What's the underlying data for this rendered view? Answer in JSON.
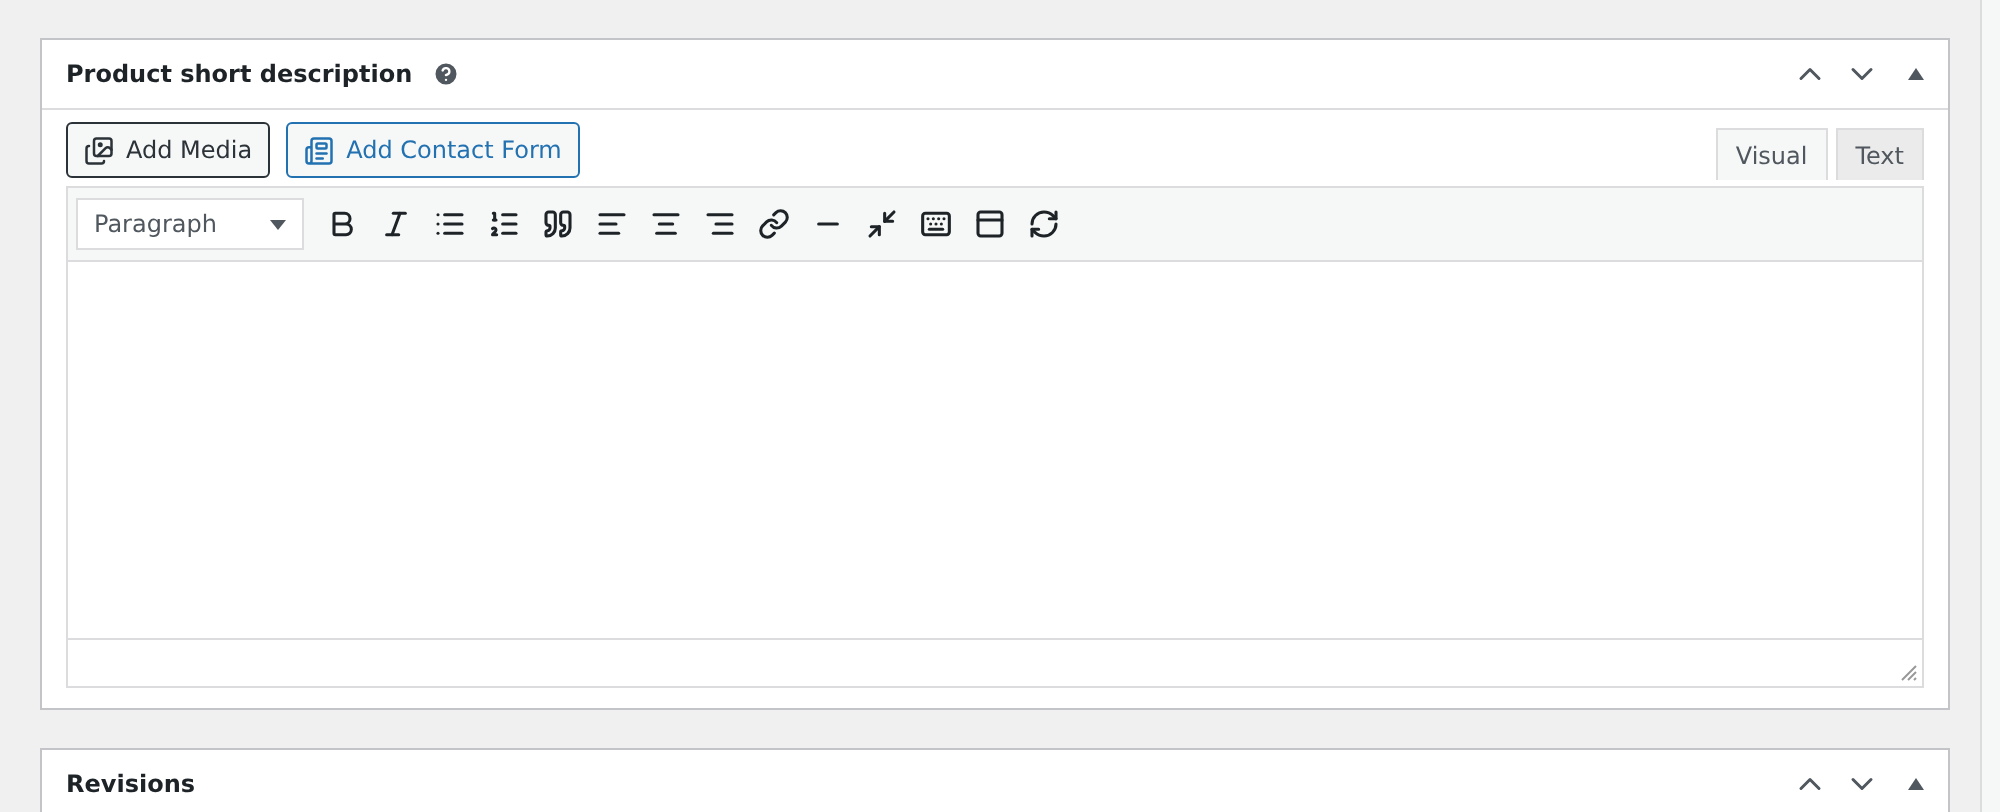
{
  "panel": {
    "title": "Product short description"
  },
  "media_buttons": [
    {
      "kind": "media",
      "label": "Add Media"
    },
    {
      "kind": "form",
      "label": "Add Contact Form"
    }
  ],
  "tabs": [
    {
      "label": "Visual",
      "selected": true
    },
    {
      "label": "Text",
      "selected": false
    }
  ],
  "format_select": {
    "value": "Paragraph"
  },
  "toolbar": [
    {
      "kind": "bold"
    },
    {
      "kind": "italic"
    },
    {
      "kind": "bullets"
    },
    {
      "kind": "numbers"
    },
    {
      "kind": "quote"
    },
    {
      "kind": "left"
    },
    {
      "kind": "center"
    },
    {
      "kind": "right"
    },
    {
      "kind": "link"
    },
    {
      "kind": "more"
    },
    {
      "kind": "fullscreen"
    },
    {
      "kind": "keyboard"
    },
    {
      "kind": "form"
    },
    {
      "kind": "refresh"
    }
  ],
  "next_panel": {
    "title": "Revisions"
  }
}
